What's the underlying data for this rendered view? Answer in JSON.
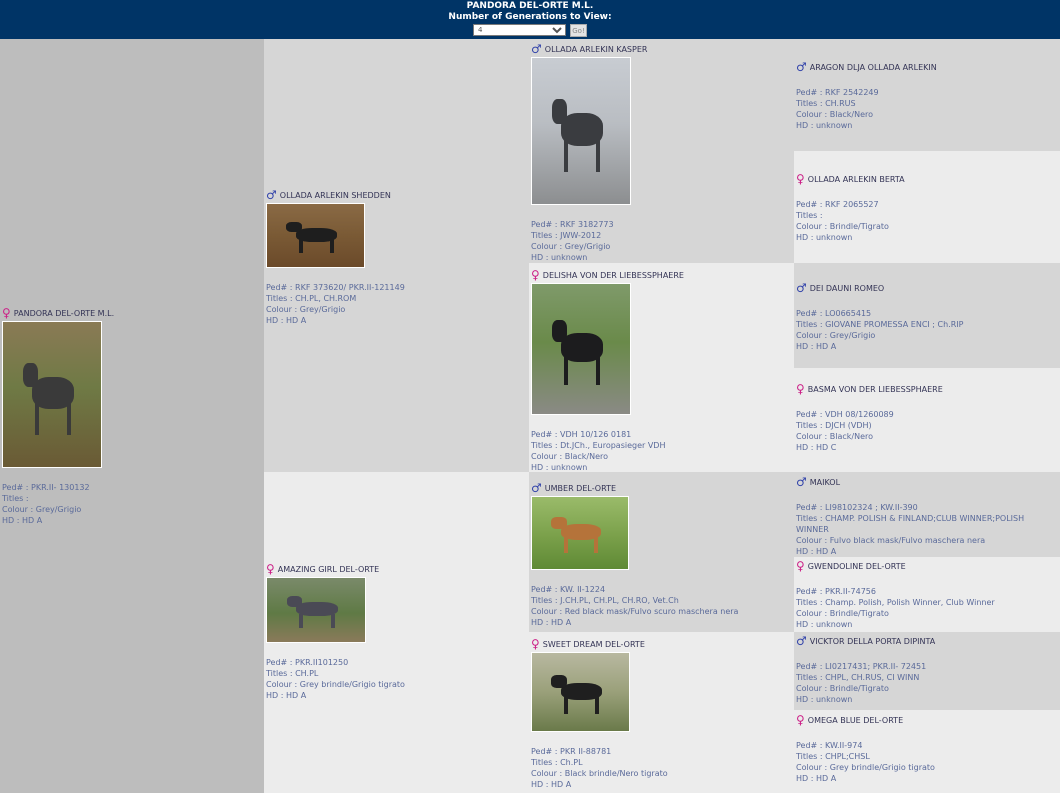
{
  "header": {
    "title": "PANDORA DEL-ORTE M.L.",
    "subtitle": "Number of Generations to View:",
    "generations_value": "4",
    "go_label": "Go!"
  },
  "labels": {
    "ped": "Ped# : ",
    "titles": "Titles : ",
    "colour": "Colour : ",
    "hd": "HD : "
  },
  "colors": {
    "header_bg": "#003466",
    "male": "#3344aa",
    "female": "#cc2288"
  },
  "dogs": {
    "pandora": {
      "sex": "female",
      "name": "PANDORA DEL-ORTE M.L.",
      "ped": "PKR.II- 130132",
      "titles": "",
      "colour": "Grey/Grigio",
      "hd": "HD A"
    },
    "shedden": {
      "sex": "male",
      "name": "OLLADA ARLEKIN SHEDDEN",
      "ped": "RKF 373620/ PKR.II-121149",
      "titles": "CH.PL, CH.ROM",
      "colour": "Grey/Grigio",
      "hd": "HD A"
    },
    "amazing": {
      "sex": "female",
      "name": "AMAZING GIRL DEL-ORTE",
      "ped": "PKR.II101250",
      "titles": "CH.PL",
      "colour": "Grey brindle/Grigio tigrato",
      "hd": "HD A"
    },
    "kasper": {
      "sex": "male",
      "name": "OLLADA ARLEKIN KASPER",
      "ped": "RKF 3182773",
      "titles": "JWW-2012",
      "colour": "Grey/Grigio",
      "hd": "unknown"
    },
    "delisha": {
      "sex": "female",
      "name": "DELISHA VON DER LIEBESSPHAERE",
      "ped": "VDH 10/126 0181",
      "titles": "Dt.JCh., Europasieger VDH",
      "colour": "Black/Nero",
      "hd": "unknown"
    },
    "umber": {
      "sex": "male",
      "name": "UMBER DEL-ORTE",
      "ped": "KW. II-1224",
      "titles": "J.CH.PL, CH.PL, CH.RO, Vet.Ch",
      "colour": "Red black mask/Fulvo scuro maschera nera",
      "hd": "HD A"
    },
    "sweet": {
      "sex": "female",
      "name": "SWEET DREAM DEL-ORTE",
      "ped": "PKR II-88781",
      "titles": "Ch.PL",
      "colour": "Black brindle/Nero tigrato",
      "hd": "HD A"
    },
    "aragon": {
      "sex": "male",
      "name": "ARAGON DLJA OLLADA ARLEKIN",
      "ped": "RKF 2542249",
      "titles": "CH.RUS",
      "colour": "Black/Nero",
      "hd": "unknown"
    },
    "berta": {
      "sex": "female",
      "name": "OLLADA ARLEKIN BERTA",
      "ped": "RKF 2065527",
      "titles": "",
      "colour": "Brindle/Tigrato",
      "hd": "unknown"
    },
    "romeo": {
      "sex": "male",
      "name": "DEI DAUNI ROMEO",
      "ped": "LO0665415",
      "titles": "GIOVANE PROMESSA ENCI ; Ch.RIP",
      "colour": "Grey/Grigio",
      "hd": "HD A"
    },
    "basma": {
      "sex": "female",
      "name": "BASMA VON DER LIEBESSPHAERE",
      "ped": "VDH 08/1260089",
      "titles": "DJCH (VDH)",
      "colour": "Black/Nero",
      "hd": "HD C"
    },
    "maikol": {
      "sex": "male",
      "name": "MAIKOL",
      "ped": "LI98102324 ; KW.II-390",
      "titles": "CHAMP. POLISH & FINLAND;CLUB WINNER;POLISH WINNER",
      "colour": "Fulvo black mask/Fulvo maschera nera",
      "hd": "HD A"
    },
    "gwendoline": {
      "sex": "female",
      "name": "GWENDOLINE DEL-ORTE",
      "ped": "PKR.II-74756",
      "titles": "Champ. Polish, Polish Winner, Club Winner",
      "colour": "Brindle/Tigrato",
      "hd": "unknown"
    },
    "vicktor": {
      "sex": "male",
      "name": "VICKTOR DELLA PORTA DIPINTA",
      "ped": "LI0217431; PKR.II- 72451",
      "titles": "CHPL, CH.RUS, CI WINN",
      "colour": "Brindle/Tigrato",
      "hd": "unknown"
    },
    "omega": {
      "sex": "female",
      "name": "OMEGA BLUE DEL-ORTE",
      "ped": "KW.II-974",
      "titles": "CHPL;CHSL",
      "colour": "Grey brindle/Grigio tigrato",
      "hd": "HD A"
    }
  }
}
